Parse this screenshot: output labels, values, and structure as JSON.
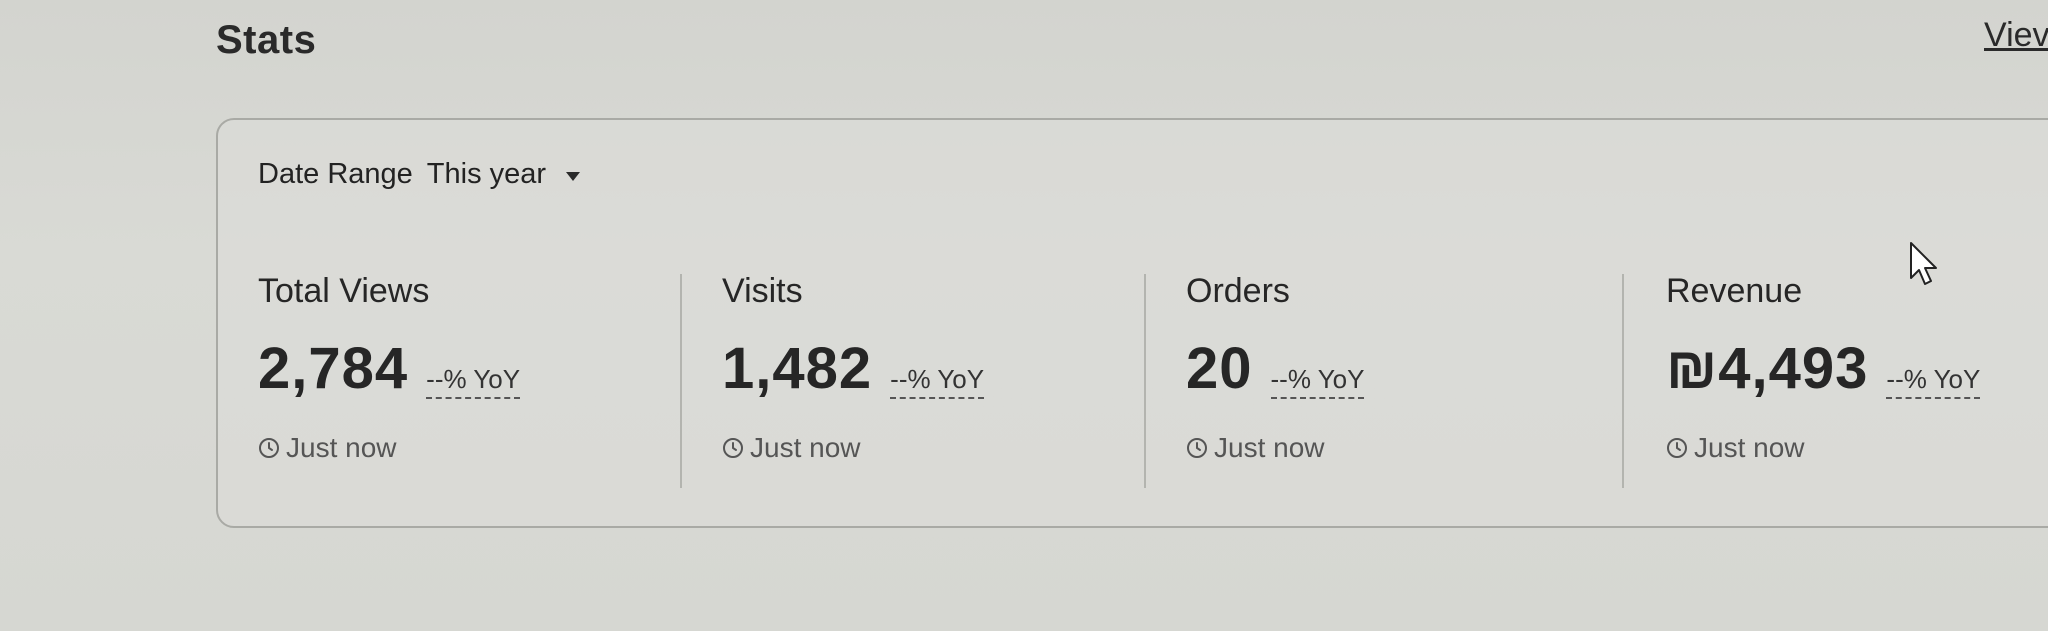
{
  "header": {
    "title": "Stats",
    "view_link": "Viev"
  },
  "date_range": {
    "label": "Date Range",
    "value": "This year",
    "icon": "caret-down-icon"
  },
  "metrics": [
    {
      "label": "Total Views",
      "value": "2,784",
      "change": "--% YoY",
      "updated": "Just now"
    },
    {
      "label": "Visits",
      "value": "1,482",
      "change": "--% YoY",
      "updated": "Just now"
    },
    {
      "label": "Orders",
      "value": "20",
      "change": "--% YoY",
      "updated": "Just now"
    },
    {
      "label": "Revenue",
      "value": "₪4,493",
      "change": "--% YoY",
      "updated": "Just now"
    }
  ],
  "icons": {
    "updated": "clock-icon",
    "pointer": "cursor-icon"
  },
  "colors": {
    "background": "#d6d7d2",
    "card_border": "#a9aaa5",
    "text": "#262626",
    "muted_text": "#555555"
  }
}
